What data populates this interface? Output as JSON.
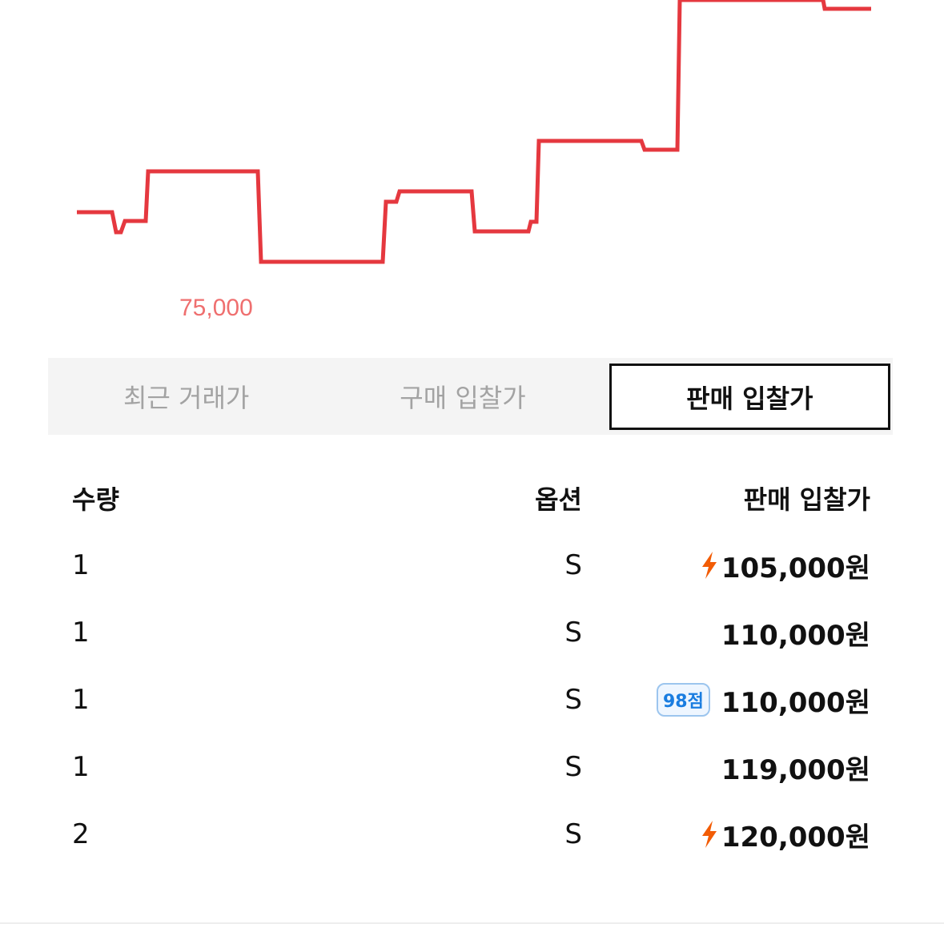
{
  "chart": {
    "line_color": "#e5383f",
    "min_price_label": "75,000"
  },
  "tabs": [
    {
      "label": "최근 거래가",
      "active": false
    },
    {
      "label": "구매 입찰가",
      "active": false
    },
    {
      "label": "판매 입찰가",
      "active": true
    }
  ],
  "table": {
    "headers": {
      "quantity": "수량",
      "option": "옵션",
      "price": "판매 입찰가"
    },
    "rows": [
      {
        "quantity": "1",
        "option": "S",
        "price": "105,000원",
        "icon": "lightning-icon"
      },
      {
        "quantity": "1",
        "option": "S",
        "price": "110,000원"
      },
      {
        "quantity": "1",
        "option": "S",
        "price": "110,000원",
        "badge": "98점"
      },
      {
        "quantity": "1",
        "option": "S",
        "price": "119,000원"
      },
      {
        "quantity": "2",
        "option": "S",
        "price": "120,000원",
        "icon": "lightning-icon"
      }
    ]
  },
  "colors": {
    "accent_red": "#e5383f",
    "lightning": "#f25c05",
    "badge_blue": "#1a7de0"
  }
}
